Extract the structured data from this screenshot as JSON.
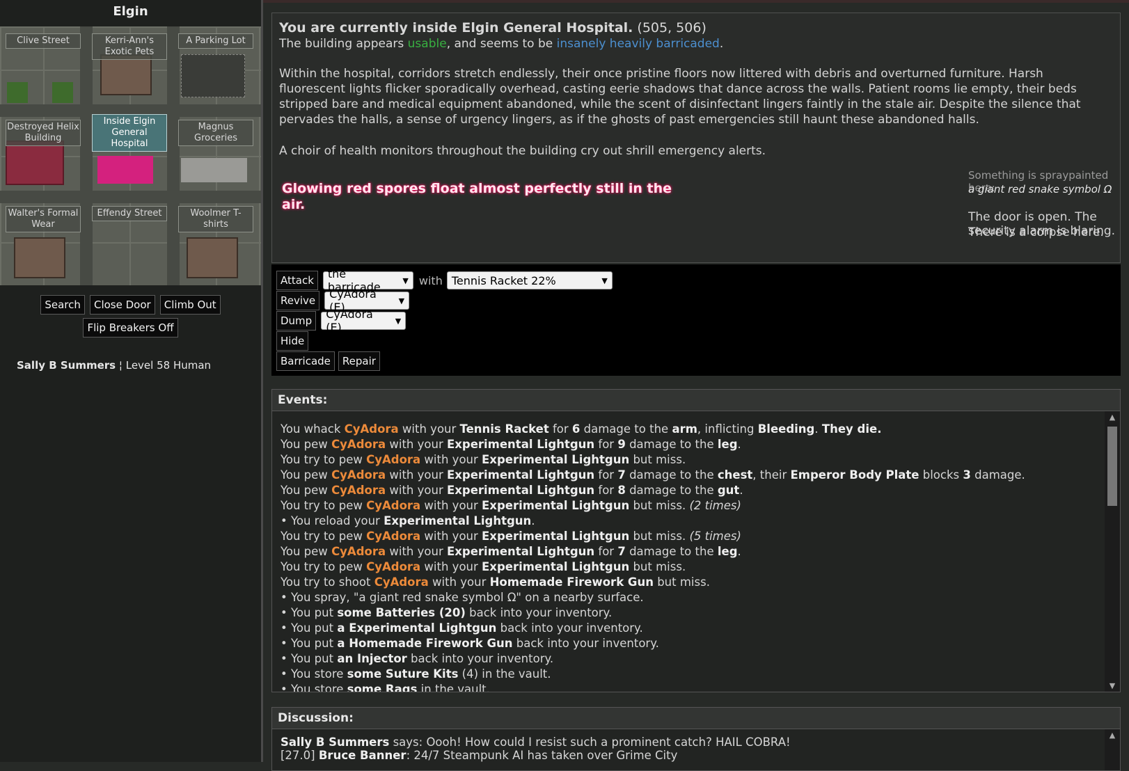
{
  "city": "Elgin",
  "map_tiles": [
    {
      "label": "Clive Street",
      "kind": "street"
    },
    {
      "label": "Kerri-Ann's Exotic Pets",
      "kind": "building"
    },
    {
      "label": "A Parking Lot",
      "kind": "parking"
    },
    {
      "label": "Destroyed Helix Building",
      "kind": "ruin"
    },
    {
      "label": "Inside Elgin General Hospital",
      "kind": "hospital"
    },
    {
      "label": "Magnus Groceries",
      "kind": "building"
    },
    {
      "label": "Walter's Formal Wear",
      "kind": "building"
    },
    {
      "label": "Effendy Street",
      "kind": "street"
    },
    {
      "label": "Woolmer T-shirts",
      "kind": "building"
    }
  ],
  "left_actions": {
    "search": "Search",
    "close_door": "Close Door",
    "climb_out": "Climb Out",
    "flip_breakers": "Flip Breakers Off"
  },
  "character": {
    "name": "Sally B Summers",
    "separator": "¦",
    "level_text": "Level 58 Human"
  },
  "description": {
    "title": "You are currently inside Elgin General Hospital.",
    "coords": "(505, 506)",
    "status_prefix": "The building appears",
    "status_usable": "usable",
    "status_mid": ", and seems to be",
    "status_barricade": "insanely heavily barricaded",
    "status_end": ".",
    "paragraph": "Within the hospital, corridors stretch endlessly, their once pristine floors now littered with debris and overturned furniture. Harsh fluorescent lights flicker sporadically overhead, casting eerie shadows that dance across the walls. Patient rooms lie empty, their beds stripped bare and medical equipment abandoned, while the scent of disinfectant lingers faintly in the stale air. Despite the silence that pervades the halls, a sense of urgency lingers, as if the ghosts of past emergencies still haunt these abandoned halls.",
    "choir": "A choir of health monitors throughout the building cry out shrill emergency alerts.",
    "spores": "Glowing red spores float almost perfectly still in the air.",
    "spray_label": "Something is spraypainted here:",
    "spray_text": "a giant red snake symbol Ω",
    "door": "The door is open. The security alarm is blaring.",
    "corpse": "There is a corpse here."
  },
  "actions": {
    "attack": "Attack",
    "attack_target": "the barricade",
    "with": "with",
    "weapon": "Tennis Racket 22%",
    "revive": "Revive",
    "revive_target": "CyAdora (E)",
    "dump": "Dump",
    "dump_target": "CyAdora (E)",
    "hide": "Hide",
    "barricade": "Barricade",
    "repair": "Repair"
  },
  "events": {
    "heading": "Events:",
    "lines": [
      [
        [
          "t",
          "You whack "
        ],
        [
          "n",
          "CyAdora"
        ],
        [
          "t",
          " with your "
        ],
        [
          "b",
          "Tennis Racket"
        ],
        [
          "t",
          " for "
        ],
        [
          "b",
          "6"
        ],
        [
          "t",
          " damage to the "
        ],
        [
          "b",
          "arm"
        ],
        [
          "t",
          ", inflicting "
        ],
        [
          "b",
          "Bleeding"
        ],
        [
          "t",
          ". "
        ],
        [
          "b",
          "They die."
        ]
      ],
      [
        [
          "t",
          "You pew "
        ],
        [
          "n",
          "CyAdora"
        ],
        [
          "t",
          " with your "
        ],
        [
          "b",
          "Experimental Lightgun"
        ],
        [
          "t",
          " for "
        ],
        [
          "b",
          "9"
        ],
        [
          "t",
          " damage to the "
        ],
        [
          "b",
          "leg"
        ],
        [
          "t",
          "."
        ]
      ],
      [
        [
          "t",
          "You try to pew "
        ],
        [
          "n",
          "CyAdora"
        ],
        [
          "t",
          " with your "
        ],
        [
          "b",
          "Experimental Lightgun"
        ],
        [
          "t",
          " but miss."
        ]
      ],
      [
        [
          "t",
          "You pew "
        ],
        [
          "n",
          "CyAdora"
        ],
        [
          "t",
          " with your "
        ],
        [
          "b",
          "Experimental Lightgun"
        ],
        [
          "t",
          " for "
        ],
        [
          "b",
          "7"
        ],
        [
          "t",
          " damage to the "
        ],
        [
          "b",
          "chest"
        ],
        [
          "t",
          ", their "
        ],
        [
          "b",
          "Emperor Body Plate"
        ],
        [
          "t",
          " blocks "
        ],
        [
          "b",
          "3"
        ],
        [
          "t",
          " damage."
        ]
      ],
      [
        [
          "t",
          "You pew "
        ],
        [
          "n",
          "CyAdora"
        ],
        [
          "t",
          " with your "
        ],
        [
          "b",
          "Experimental Lightgun"
        ],
        [
          "t",
          " for "
        ],
        [
          "b",
          "8"
        ],
        [
          "t",
          " damage to the "
        ],
        [
          "b",
          "gut"
        ],
        [
          "t",
          "."
        ]
      ],
      [
        [
          "t",
          "You try to pew "
        ],
        [
          "n",
          "CyAdora"
        ],
        [
          "t",
          " with your "
        ],
        [
          "b",
          "Experimental Lightgun"
        ],
        [
          "t",
          " but miss. "
        ],
        [
          "i",
          "(2 times)"
        ]
      ],
      [
        [
          "t",
          "• You reload your "
        ],
        [
          "b",
          "Experimental Lightgun"
        ],
        [
          "t",
          "."
        ]
      ],
      [
        [
          "t",
          "You try to pew "
        ],
        [
          "n",
          "CyAdora"
        ],
        [
          "t",
          " with your "
        ],
        [
          "b",
          "Experimental Lightgun"
        ],
        [
          "t",
          " but miss. "
        ],
        [
          "i",
          "(5 times)"
        ]
      ],
      [
        [
          "t",
          "You pew "
        ],
        [
          "n",
          "CyAdora"
        ],
        [
          "t",
          " with your "
        ],
        [
          "b",
          "Experimental Lightgun"
        ],
        [
          "t",
          " for "
        ],
        [
          "b",
          "7"
        ],
        [
          "t",
          " damage to the "
        ],
        [
          "b",
          "leg"
        ],
        [
          "t",
          "."
        ]
      ],
      [
        [
          "t",
          "You try to pew "
        ],
        [
          "n",
          "CyAdora"
        ],
        [
          "t",
          " with your "
        ],
        [
          "b",
          "Experimental Lightgun"
        ],
        [
          "t",
          " but miss."
        ]
      ],
      [
        [
          "t",
          "You try to shoot "
        ],
        [
          "n",
          "CyAdora"
        ],
        [
          "t",
          " with your "
        ],
        [
          "b",
          "Homemade Firework Gun"
        ],
        [
          "t",
          " but miss."
        ]
      ],
      [
        [
          "t",
          "• You spray, \"a giant red snake symbol Ω\" on a nearby surface."
        ]
      ],
      [
        [
          "t",
          "• You put "
        ],
        [
          "b",
          "some Batteries (20)"
        ],
        [
          "t",
          " back into your inventory."
        ]
      ],
      [
        [
          "t",
          "• You put "
        ],
        [
          "b",
          "a Experimental Lightgun"
        ],
        [
          "t",
          " back into your inventory."
        ]
      ],
      [
        [
          "t",
          "• You put "
        ],
        [
          "b",
          "a Homemade Firework Gun"
        ],
        [
          "t",
          " back into your inventory."
        ]
      ],
      [
        [
          "t",
          "• You put "
        ],
        [
          "b",
          "an Injector"
        ],
        [
          "t",
          " back into your inventory."
        ]
      ],
      [
        [
          "t",
          "• You store "
        ],
        [
          "b",
          "some Suture Kits"
        ],
        [
          "t",
          " (4) in the vault."
        ]
      ],
      [
        [
          "t",
          "• You store "
        ],
        [
          "b",
          "some Rags"
        ],
        [
          "t",
          " in the vault."
        ]
      ]
    ]
  },
  "discussion": {
    "heading": "Discussion:",
    "lines": [
      [
        [
          "b",
          "Sally B Summers"
        ],
        [
          "t",
          " says: Oooh! How could I resist such a prominent catch? HAIL COBRA!"
        ]
      ],
      [
        [
          "t",
          "[27.0] "
        ],
        [
          "b",
          "Bruce Banner"
        ],
        [
          "t",
          ": 24/7 Steampunk AI has taken over Grime City"
        ]
      ]
    ]
  },
  "colors": {
    "accent_usable": "#38b041",
    "accent_barricade": "#4c8fcf",
    "enemy_name": "#ec8a3a",
    "spore_glow": "#ff1a6e",
    "hospital_tile": "#d4217e"
  }
}
